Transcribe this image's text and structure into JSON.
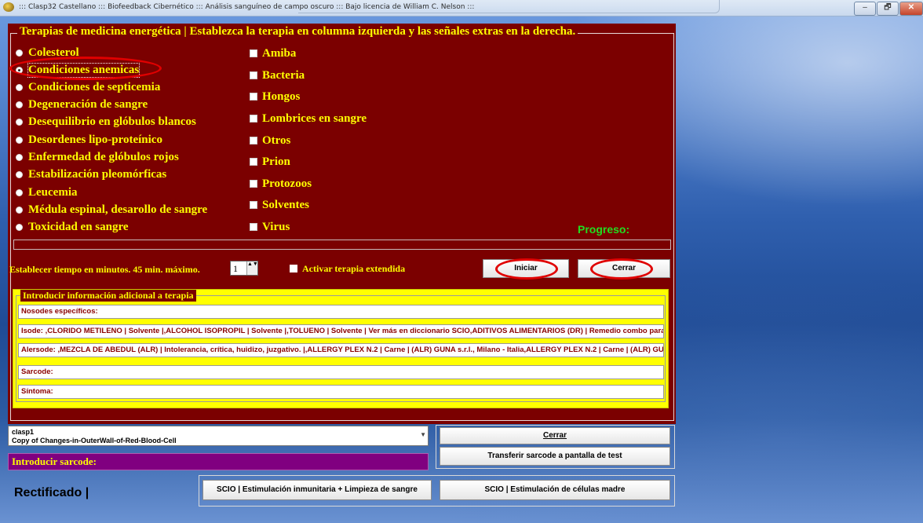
{
  "window": {
    "title": "::: Clasp32 Castellano ::: Biofeedback Cibernético ::: Análisis sanguíneo de campo oscuro ::: Bajo licencia de William C. Nelson :::",
    "min_glyph": "‒",
    "max_glyph": "🗗",
    "close_glyph": "✕"
  },
  "therapy_panel": {
    "legend": "Terapias de medicina energética | Establezca la terapia en columna izquierda y las señales extras en la derecha.",
    "therapies": [
      {
        "label": "Colesterol",
        "checked": false
      },
      {
        "label": "Condiciones anemicas",
        "checked": true
      },
      {
        "label": "Condiciones de septicemia",
        "checked": false
      },
      {
        "label": "Degeneración de sangre",
        "checked": false
      },
      {
        "label": "Desequilibrio en glóbulos blancos",
        "checked": false
      },
      {
        "label": "Desordenes lipo-proteínico",
        "checked": false
      },
      {
        "label": "Enfermedad de glóbulos rojos",
        "checked": false
      },
      {
        "label": "Estabilización pleomórficas",
        "checked": false
      },
      {
        "label": "Leucemia",
        "checked": false
      },
      {
        "label": "Médula espinal, desarollo de sangre",
        "checked": false
      },
      {
        "label": "Toxicidad en sangre",
        "checked": false
      }
    ],
    "signals": [
      "Amiba",
      "Bacteria",
      "Hongos",
      "Lombrices en sangre",
      "Otros",
      "Prion",
      "Protozoos",
      "Solventes",
      "Virus"
    ],
    "progress_label": "Progreso:",
    "progress_value": 0,
    "timer_label": "Establecer tiempo en minutos. 45 min. máximo.",
    "timer_value": "1",
    "spin_arrows": "▲▼",
    "extended_label": "Activar terapia extendida",
    "start_button": "Iniciar",
    "close_button": "Cerrar"
  },
  "additional_info": {
    "legend": "Introducir información adicional a terapia",
    "nosodes": "Nosodes específicos:",
    "isode": "Isode: ,CLORIDO METILENO | Solvente |,ALCOHOL ISOPROPIL  | Solvente |,TOLUENO | Solvente | Ver más en diccionario SCIO,ADITIVOS ALIMENTARIOS (DR) | Remedio combo para",
    "alersode": "Alersode: ,MEZCLA DE ABEDUL (ALR) | Intolerancia, crítica, huidizo, juzgativo. |,ALLERGY PLEX N.2 | Carne | (ALR) GUNA s.r.l., Milano - Italia,ALLERGY PLEX N.2 | Carne | (ALR) GUN",
    "sarcode": "Sarcode:",
    "sintoma": "Síntoma:"
  },
  "bottom": {
    "combo_line1": "clasp1",
    "combo_line2": "Copy of Changes-in-OuterWall-of-Red-Blood-Cell",
    "combo_arrow": "▼",
    "sarcode_bar": "Introducir sarcode:",
    "close_button": "Cerrar",
    "transfer_button": "Transferir sarcode a pantalla de test",
    "status": "Rectificado |",
    "scio1_button": "SCIO | Estimulación inmunitaria + Limpieza de sangre",
    "scio2_button": "SCIO | Estimulación de células madre"
  },
  "colors": {
    "panel_bg": "#7b0000",
    "label_yellow": "#ffff00",
    "progress_green": "#22dd22",
    "sarcode_purple": "#800080",
    "highlight_red": "#e00000"
  }
}
